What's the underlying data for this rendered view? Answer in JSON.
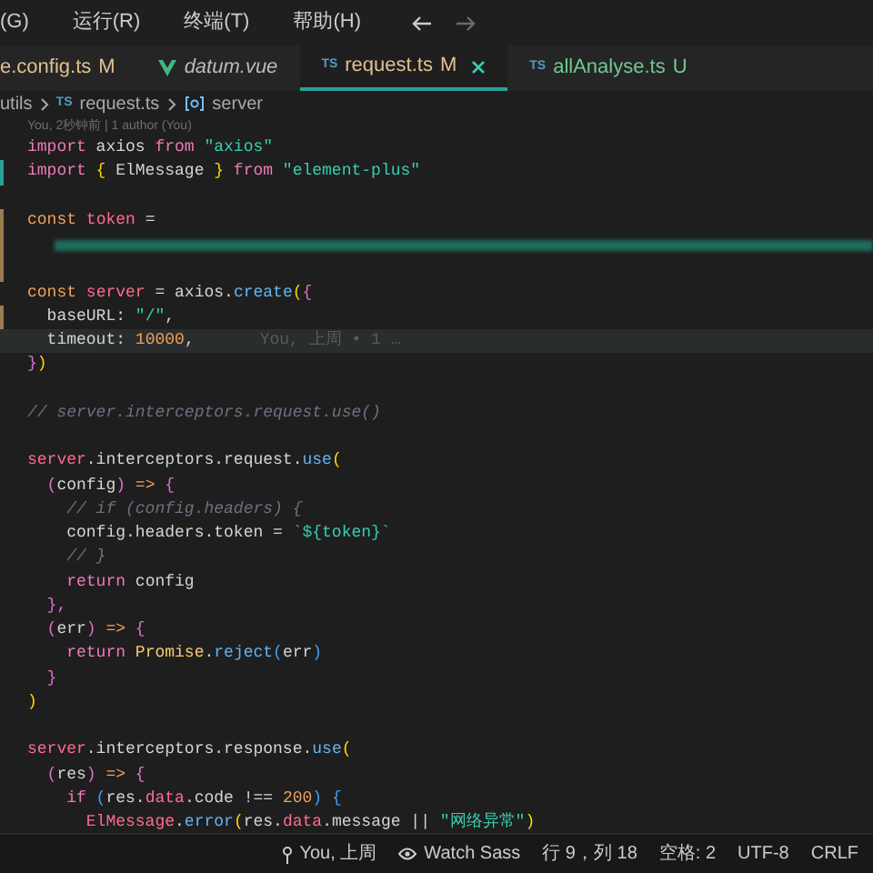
{
  "menu": [
    {
      "label": "(G)"
    },
    {
      "label": "运行(R)"
    },
    {
      "label": "终端(T)"
    },
    {
      "label": "帮助(H)"
    }
  ],
  "tabs": [
    {
      "label": "e.config.ts",
      "badge": "M",
      "color": "#e2c08d",
      "kind": "ts",
      "italic": false,
      "selected": false
    },
    {
      "label": "datum.vue",
      "kind": "vue",
      "italic": true,
      "selected": false
    },
    {
      "label": "request.ts",
      "badge": "M",
      "color": "#e2c08d",
      "kind": "ts",
      "icon_text": "TS",
      "italic": false,
      "selected": true
    },
    {
      "label": "allAnalyse.ts",
      "badge": "U",
      "color": "#73c991",
      "kind": "ts",
      "icon_text": "TS",
      "italic": false,
      "selected": false
    }
  ],
  "breadcrumb": {
    "folder": "utils",
    "file_icon": "TS",
    "file": "request.ts",
    "symbol": "server"
  },
  "codelens": "You, 2秒钟前 | 1 author (You)",
  "lines": [
    {
      "kind": "code",
      "tokens": [
        {
          "text": "import",
          "kind": "kw"
        },
        {
          "text": " axios ",
          "kind": "p"
        },
        {
          "text": "from",
          "kind": "kw"
        },
        {
          "text": " \"axios\"",
          "kind": "str"
        }
      ]
    },
    {
      "kind": "code",
      "color": "#2aa198",
      "tokens": [
        {
          "text": "import",
          "kind": "kw"
        },
        {
          "text": " { ",
          "kind": "b1"
        },
        {
          "text": "ElMessage",
          "kind": "p"
        },
        {
          "text": " } ",
          "kind": "b1"
        },
        {
          "text": "from",
          "kind": "kw"
        },
        {
          "text": " \"element-plus\"",
          "kind": "str"
        }
      ]
    },
    {
      "kind": "blank"
    },
    {
      "kind": "code",
      "color": "#9c7b4e",
      "tokens": [
        {
          "text": "const",
          "kind": "decl"
        },
        {
          "text": " token",
          "kind": "var"
        },
        {
          "text": " =",
          "kind": "p"
        }
      ]
    },
    {
      "kind": "redacted",
      "color": "#9c7b4e"
    },
    {
      "kind": "blank",
      "color": "#9c7b4e"
    },
    {
      "kind": "code",
      "tokens": [
        {
          "text": "const",
          "kind": "decl"
        },
        {
          "text": " server",
          "kind": "var"
        },
        {
          "text": " = axios.",
          "kind": "p"
        },
        {
          "text": "create",
          "kind": "fn"
        },
        {
          "text": "(",
          "kind": "b1"
        },
        {
          "text": "{",
          "kind": "b2"
        }
      ]
    },
    {
      "kind": "code",
      "color": "#9c7b4e",
      "tokens": [
        {
          "text": "  baseURL: ",
          "kind": "p"
        },
        {
          "text": "\"/\"",
          "kind": "str"
        },
        {
          "text": ",",
          "kind": "p"
        }
      ]
    },
    {
      "kind": "code",
      "current": true,
      "blame": "You, 上周 • 1 …",
      "tokens": [
        {
          "text": "  timeout: ",
          "kind": "p"
        },
        {
          "text": "10000",
          "kind": "num"
        },
        {
          "text": ",",
          "kind": "p"
        }
      ]
    },
    {
      "kind": "code",
      "tokens": [
        {
          "text": "}",
          "kind": "b2"
        },
        {
          "text": ")",
          "kind": "b1"
        }
      ]
    },
    {
      "kind": "blank"
    },
    {
      "kind": "code",
      "tokens": [
        {
          "text": "// server.interceptors.request.use()",
          "kind": "cm"
        }
      ]
    },
    {
      "kind": "blank"
    },
    {
      "kind": "code",
      "tokens": [
        {
          "text": "server",
          "kind": "var"
        },
        {
          "text": ".interceptors.request.",
          "kind": "p"
        },
        {
          "text": "use",
          "kind": "fn"
        },
        {
          "text": "(",
          "kind": "b1"
        }
      ]
    },
    {
      "kind": "code",
      "tokens": [
        {
          "text": "  (",
          "kind": "b2"
        },
        {
          "text": "config",
          "kind": "p"
        },
        {
          "text": ")",
          "kind": "b2"
        },
        {
          "text": " => ",
          "kind": "decl"
        },
        {
          "text": "{",
          "kind": "b2"
        }
      ]
    },
    {
      "kind": "code",
      "tokens": [
        {
          "text": "    // if (config.headers) {",
          "kind": "cm"
        }
      ]
    },
    {
      "kind": "code",
      "tokens": [
        {
          "text": "    config.headers.token = ",
          "kind": "p"
        },
        {
          "text": "`${token}`",
          "kind": "str"
        }
      ]
    },
    {
      "kind": "code",
      "tokens": [
        {
          "text": "    // }",
          "kind": "cm"
        }
      ]
    },
    {
      "kind": "code",
      "tokens": [
        {
          "text": "    return",
          "kind": "kw"
        },
        {
          "text": " config",
          "kind": "p"
        }
      ]
    },
    {
      "kind": "code",
      "tokens": [
        {
          "text": "  },",
          "kind": "b2"
        }
      ]
    },
    {
      "kind": "code",
      "tokens": [
        {
          "text": "  (",
          "kind": "b2"
        },
        {
          "text": "err",
          "kind": "p"
        },
        {
          "text": ")",
          "kind": "b2"
        },
        {
          "text": " => ",
          "kind": "decl"
        },
        {
          "text": "{",
          "kind": "b2"
        }
      ]
    },
    {
      "kind": "code",
      "tokens": [
        {
          "text": "    return",
          "kind": "kw"
        },
        {
          "text": " Promise",
          "kind": "cls"
        },
        {
          "text": ".",
          "kind": "p"
        },
        {
          "text": "reject",
          "kind": "fn"
        },
        {
          "text": "(",
          "kind": "b3"
        },
        {
          "text": "err",
          "kind": "p"
        },
        {
          "text": ")",
          "kind": "b3"
        }
      ]
    },
    {
      "kind": "code",
      "tokens": [
        {
          "text": "  }",
          "kind": "b2"
        }
      ]
    },
    {
      "kind": "code",
      "tokens": [
        {
          "text": ")",
          "kind": "b1"
        }
      ]
    },
    {
      "kind": "blank"
    },
    {
      "kind": "code",
      "tokens": [
        {
          "text": "server",
          "kind": "var"
        },
        {
          "text": ".interceptors.response.",
          "kind": "p"
        },
        {
          "text": "use",
          "kind": "fn"
        },
        {
          "text": "(",
          "kind": "b1"
        }
      ]
    },
    {
      "kind": "code",
      "tokens": [
        {
          "text": "  (",
          "kind": "b2"
        },
        {
          "text": "res",
          "kind": "p"
        },
        {
          "text": ")",
          "kind": "b2"
        },
        {
          "text": " => ",
          "kind": "decl"
        },
        {
          "text": "{",
          "kind": "b2"
        }
      ]
    },
    {
      "kind": "code",
      "tokens": [
        {
          "text": "    if",
          "kind": "kw"
        },
        {
          "text": " (",
          "kind": "b3"
        },
        {
          "text": "res.",
          "kind": "p"
        },
        {
          "text": "data",
          "kind": "var"
        },
        {
          "text": ".code !== ",
          "kind": "p"
        },
        {
          "text": "200",
          "kind": "num"
        },
        {
          "text": ") {",
          "kind": "b3"
        }
      ]
    },
    {
      "kind": "code",
      "tokens": [
        {
          "text": "      ElMessage",
          "kind": "var"
        },
        {
          "text": ".",
          "kind": "p"
        },
        {
          "text": "error",
          "kind": "fn"
        },
        {
          "text": "(",
          "kind": "b1"
        },
        {
          "text": "res.",
          "kind": "p"
        },
        {
          "text": "data",
          "kind": "var"
        },
        {
          "text": ".message || ",
          "kind": "p"
        },
        {
          "text": "\"网络异常\"",
          "kind": "str"
        },
        {
          "text": ")",
          "kind": "b1"
        }
      ]
    }
  ],
  "status_bar": [
    {
      "kind": "git",
      "text": "You, 上周"
    },
    {
      "kind": "eye",
      "text": "Watch Sass"
    },
    {
      "kind": "text",
      "text": "行 9，列 18"
    },
    {
      "kind": "text",
      "text": "空格: 2"
    },
    {
      "kind": "text",
      "text": "UTF-8"
    },
    {
      "kind": "text",
      "text": "CRLF"
    }
  ]
}
